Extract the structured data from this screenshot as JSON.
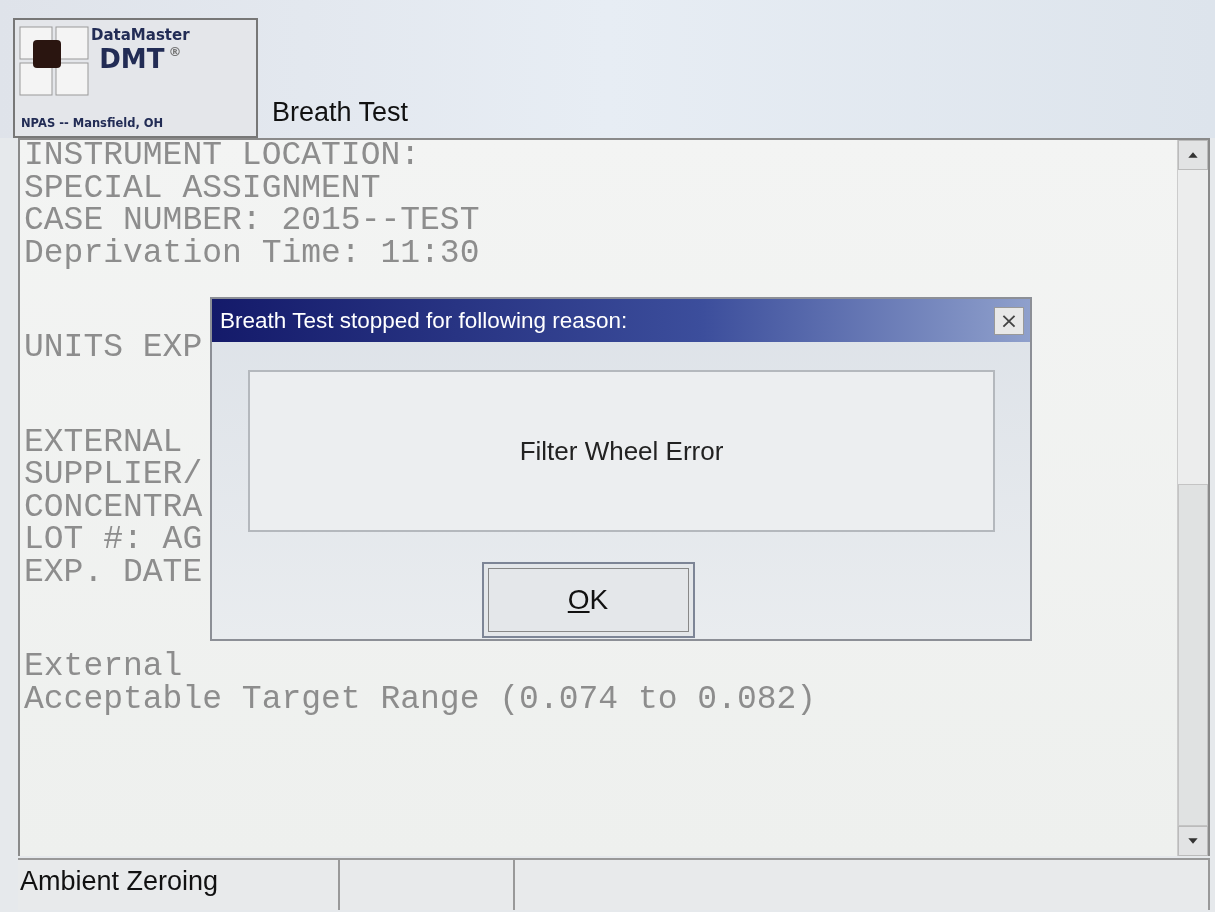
{
  "header": {
    "logo": {
      "line_1": "DataMaster",
      "line_2": "DMT",
      "mark": "®",
      "line_3": "NPAS -- Mansfield, OH"
    },
    "title": "Breath Test"
  },
  "report": {
    "groups": [
      [
        "INSTRUMENT LOCATION:",
        "SPECIAL ASSIGNMENT",
        "CASE NUMBER: 2015--TEST",
        "Deprivation Time: 11:30"
      ],
      [
        "UNITS EXP"
      ],
      [
        "EXTERNAL",
        "SUPPLIER/",
        "CONCENTRA",
        "LOT #: AG",
        "EXP. DATE"
      ],
      [
        "External",
        "Acceptable Target Range (0.074 to 0.082)"
      ]
    ]
  },
  "dialog": {
    "title": "Breath Test stopped for following reason:",
    "close": "×",
    "message": "Filter Wheel Error",
    "buttons": [
      "OK"
    ]
  },
  "status_bar": {
    "panels": [
      "Ambient Zeroing"
    ]
  }
}
